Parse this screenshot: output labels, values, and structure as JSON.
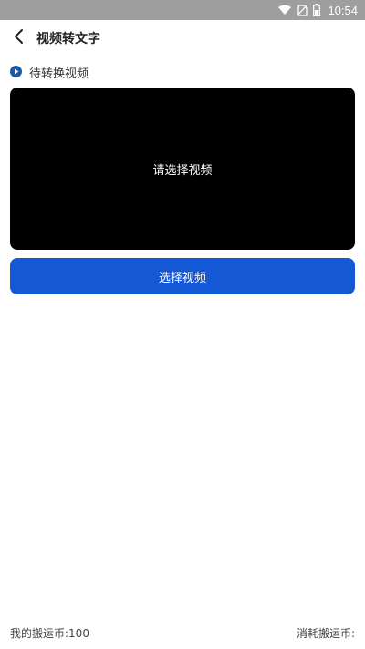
{
  "status_bar": {
    "time": "10:54",
    "icons": [
      "wifi-icon",
      "no-sim-icon",
      "battery-icon"
    ]
  },
  "header": {
    "title": "视频转文字",
    "back_icon": "chevron-left-icon"
  },
  "section": {
    "icon": "play-circle-icon",
    "label": "待转换视频"
  },
  "video": {
    "placeholder": "请选择视频"
  },
  "actions": {
    "select_label": "选择视频"
  },
  "footer": {
    "my_coins": "我的搬运币:100",
    "cost_coins": "消耗搬运币:"
  },
  "colors": {
    "accent": "#1558d6",
    "status_bar": "#9e9e9e",
    "section_icon": "#1a5aa8"
  }
}
